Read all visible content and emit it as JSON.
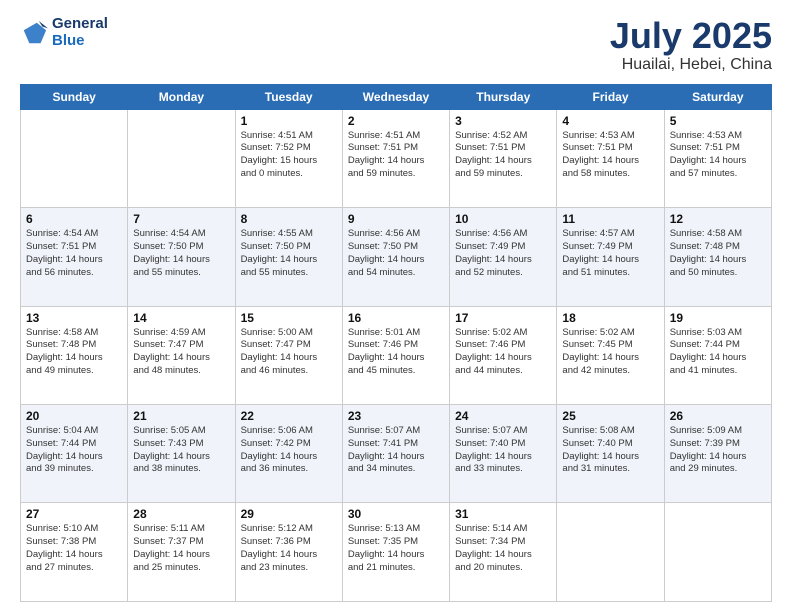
{
  "header": {
    "logo_line1": "General",
    "logo_line2": "Blue",
    "title": "July 2025",
    "subtitle": "Huailai, Hebei, China"
  },
  "weekdays": [
    "Sunday",
    "Monday",
    "Tuesday",
    "Wednesday",
    "Thursday",
    "Friday",
    "Saturday"
  ],
  "weeks": [
    [
      {
        "day": "",
        "detail": ""
      },
      {
        "day": "",
        "detail": ""
      },
      {
        "day": "1",
        "detail": "Sunrise: 4:51 AM\nSunset: 7:52 PM\nDaylight: 15 hours\nand 0 minutes."
      },
      {
        "day": "2",
        "detail": "Sunrise: 4:51 AM\nSunset: 7:51 PM\nDaylight: 14 hours\nand 59 minutes."
      },
      {
        "day": "3",
        "detail": "Sunrise: 4:52 AM\nSunset: 7:51 PM\nDaylight: 14 hours\nand 59 minutes."
      },
      {
        "day": "4",
        "detail": "Sunrise: 4:53 AM\nSunset: 7:51 PM\nDaylight: 14 hours\nand 58 minutes."
      },
      {
        "day": "5",
        "detail": "Sunrise: 4:53 AM\nSunset: 7:51 PM\nDaylight: 14 hours\nand 57 minutes."
      }
    ],
    [
      {
        "day": "6",
        "detail": "Sunrise: 4:54 AM\nSunset: 7:51 PM\nDaylight: 14 hours\nand 56 minutes."
      },
      {
        "day": "7",
        "detail": "Sunrise: 4:54 AM\nSunset: 7:50 PM\nDaylight: 14 hours\nand 55 minutes."
      },
      {
        "day": "8",
        "detail": "Sunrise: 4:55 AM\nSunset: 7:50 PM\nDaylight: 14 hours\nand 55 minutes."
      },
      {
        "day": "9",
        "detail": "Sunrise: 4:56 AM\nSunset: 7:50 PM\nDaylight: 14 hours\nand 54 minutes."
      },
      {
        "day": "10",
        "detail": "Sunrise: 4:56 AM\nSunset: 7:49 PM\nDaylight: 14 hours\nand 52 minutes."
      },
      {
        "day": "11",
        "detail": "Sunrise: 4:57 AM\nSunset: 7:49 PM\nDaylight: 14 hours\nand 51 minutes."
      },
      {
        "day": "12",
        "detail": "Sunrise: 4:58 AM\nSunset: 7:48 PM\nDaylight: 14 hours\nand 50 minutes."
      }
    ],
    [
      {
        "day": "13",
        "detail": "Sunrise: 4:58 AM\nSunset: 7:48 PM\nDaylight: 14 hours\nand 49 minutes."
      },
      {
        "day": "14",
        "detail": "Sunrise: 4:59 AM\nSunset: 7:47 PM\nDaylight: 14 hours\nand 48 minutes."
      },
      {
        "day": "15",
        "detail": "Sunrise: 5:00 AM\nSunset: 7:47 PM\nDaylight: 14 hours\nand 46 minutes."
      },
      {
        "day": "16",
        "detail": "Sunrise: 5:01 AM\nSunset: 7:46 PM\nDaylight: 14 hours\nand 45 minutes."
      },
      {
        "day": "17",
        "detail": "Sunrise: 5:02 AM\nSunset: 7:46 PM\nDaylight: 14 hours\nand 44 minutes."
      },
      {
        "day": "18",
        "detail": "Sunrise: 5:02 AM\nSunset: 7:45 PM\nDaylight: 14 hours\nand 42 minutes."
      },
      {
        "day": "19",
        "detail": "Sunrise: 5:03 AM\nSunset: 7:44 PM\nDaylight: 14 hours\nand 41 minutes."
      }
    ],
    [
      {
        "day": "20",
        "detail": "Sunrise: 5:04 AM\nSunset: 7:44 PM\nDaylight: 14 hours\nand 39 minutes."
      },
      {
        "day": "21",
        "detail": "Sunrise: 5:05 AM\nSunset: 7:43 PM\nDaylight: 14 hours\nand 38 minutes."
      },
      {
        "day": "22",
        "detail": "Sunrise: 5:06 AM\nSunset: 7:42 PM\nDaylight: 14 hours\nand 36 minutes."
      },
      {
        "day": "23",
        "detail": "Sunrise: 5:07 AM\nSunset: 7:41 PM\nDaylight: 14 hours\nand 34 minutes."
      },
      {
        "day": "24",
        "detail": "Sunrise: 5:07 AM\nSunset: 7:40 PM\nDaylight: 14 hours\nand 33 minutes."
      },
      {
        "day": "25",
        "detail": "Sunrise: 5:08 AM\nSunset: 7:40 PM\nDaylight: 14 hours\nand 31 minutes."
      },
      {
        "day": "26",
        "detail": "Sunrise: 5:09 AM\nSunset: 7:39 PM\nDaylight: 14 hours\nand 29 minutes."
      }
    ],
    [
      {
        "day": "27",
        "detail": "Sunrise: 5:10 AM\nSunset: 7:38 PM\nDaylight: 14 hours\nand 27 minutes."
      },
      {
        "day": "28",
        "detail": "Sunrise: 5:11 AM\nSunset: 7:37 PM\nDaylight: 14 hours\nand 25 minutes."
      },
      {
        "day": "29",
        "detail": "Sunrise: 5:12 AM\nSunset: 7:36 PM\nDaylight: 14 hours\nand 23 minutes."
      },
      {
        "day": "30",
        "detail": "Sunrise: 5:13 AM\nSunset: 7:35 PM\nDaylight: 14 hours\nand 21 minutes."
      },
      {
        "day": "31",
        "detail": "Sunrise: 5:14 AM\nSunset: 7:34 PM\nDaylight: 14 hours\nand 20 minutes."
      },
      {
        "day": "",
        "detail": ""
      },
      {
        "day": "",
        "detail": ""
      }
    ]
  ]
}
